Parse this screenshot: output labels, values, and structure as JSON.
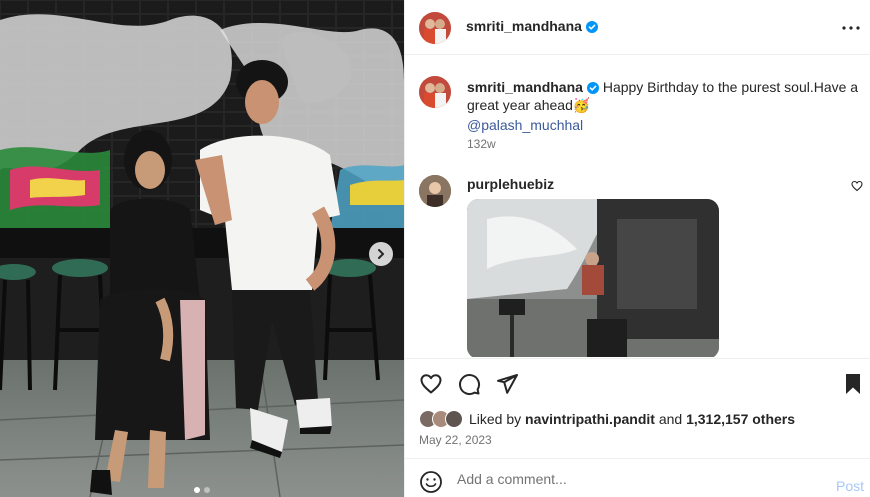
{
  "post": {
    "author": "smriti_mandhana",
    "verified": true,
    "more_icon": "more-horizontal-icon"
  },
  "caption": {
    "username": "smriti_mandhana",
    "text": "Happy Birthday to the purest soul.Have a great year ahead🥳",
    "mention": "@palash_muchhal",
    "time": "132w"
  },
  "comments": [
    {
      "username": "purplehuebiz",
      "content": "gif"
    }
  ],
  "carousel": {
    "slides": 2,
    "current": 1,
    "next_icon": "chevron-right-icon"
  },
  "actions": {
    "like_icon": "heart-outline-icon",
    "comment_icon": "comment-bubble-icon",
    "share_icon": "paper-plane-icon",
    "save_icon": "bookmark-filled-icon"
  },
  "likes": {
    "prefix": "Liked by",
    "user": "navintripathi.pandit",
    "joiner": "and",
    "others": "1,312,157 others"
  },
  "date": "May 22, 2023",
  "comment_box": {
    "placeholder": "Add a comment...",
    "post_label": "Post"
  },
  "colors": {
    "verified_blue": "#0095f6",
    "link_blue": "#3b5b9b",
    "post_button_disabled": "#a6c8f5",
    "divider": "#efefef"
  }
}
